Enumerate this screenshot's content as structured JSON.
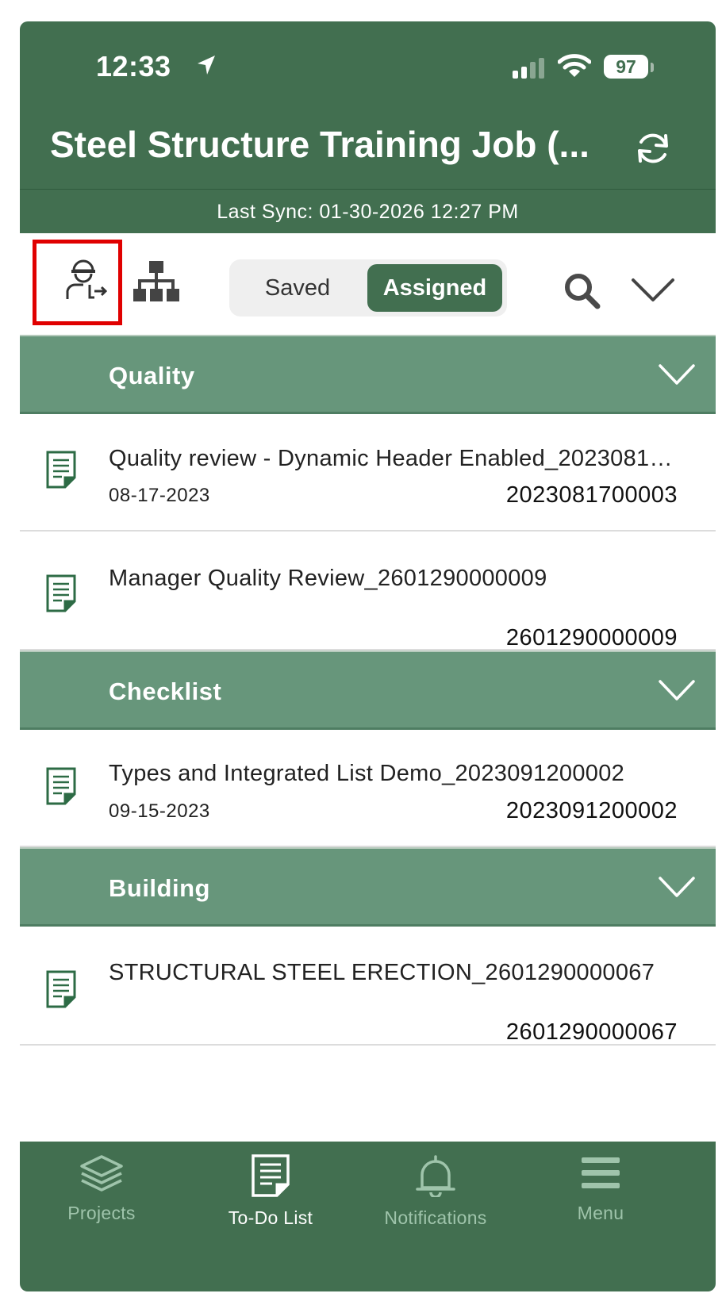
{
  "status_bar": {
    "time": "12:33",
    "battery": "97"
  },
  "header": {
    "title": "Steel Structure Training Job (...",
    "last_sync": "Last Sync: 01-30-2026 12:27 PM"
  },
  "toolbar": {
    "segments": {
      "saved": "Saved",
      "assigned": "Assigned",
      "selected": "Assigned"
    }
  },
  "sections": [
    {
      "label": "Quality",
      "items": [
        {
          "title": "Quality review - Dynamic Header Enabled_2023081700003",
          "date": "08-17-2023",
          "id": "2023081700003"
        },
        {
          "title": "Manager Quality Review_2601290000009",
          "date": "",
          "id": "2601290000009"
        }
      ]
    },
    {
      "label": "Checklist",
      "items": [
        {
          "title": "Types and Integrated List Demo_2023091200002",
          "date": "09-15-2023",
          "id": "2023091200002"
        }
      ]
    },
    {
      "label": "Building",
      "items": [
        {
          "title": "STRUCTURAL STEEL ERECTION_2601290000067",
          "date": "",
          "id": "2601290000067"
        }
      ]
    }
  ],
  "tabs": [
    {
      "label": "Projects",
      "icon": "layers-icon"
    },
    {
      "label": "To-Do List",
      "icon": "document-icon"
    },
    {
      "label": "Notifications",
      "icon": "bell-icon"
    },
    {
      "label": "Menu",
      "icon": "menu-icon"
    }
  ],
  "active_tab": "To-Do List",
  "colors": {
    "primary": "#426f50",
    "section": "#67967b",
    "highlight": "#e00000",
    "tab_inactive": "#9fc4ab"
  }
}
